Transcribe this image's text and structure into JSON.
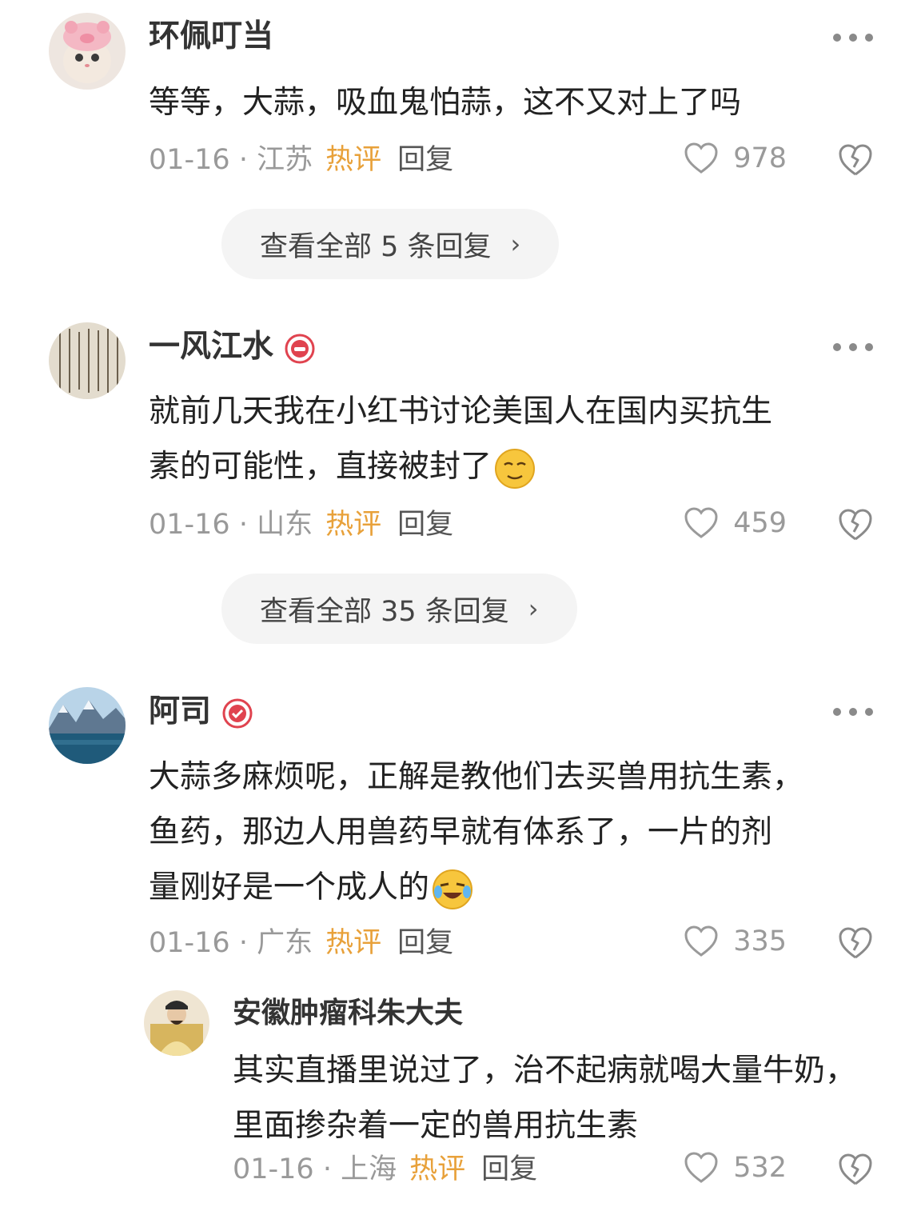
{
  "comments": [
    {
      "user": "环佩叮当",
      "text_lines": [
        "等等，大蒜，吸血鬼怕蒜，这不又对上了吗"
      ],
      "date": "01-16",
      "location": "江苏",
      "hot_label": "热评",
      "reply_label": "回复",
      "likes": "978",
      "view_replies": "查看全部 5 条回复"
    },
    {
      "user": "一风江水",
      "text_lines": [
        "就前几天我在小红书讨论美国人在国内买抗生",
        "素的可能性，直接被封了"
      ],
      "date": "01-16",
      "location": "山东",
      "hot_label": "热评",
      "reply_label": "回复",
      "likes": "459",
      "view_replies": "查看全部 35 条回复"
    },
    {
      "user": "阿司",
      "text_lines": [
        "大蒜多麻烦呢，正解是教他们去买兽用抗生素，",
        "鱼药，那边人用兽药早就有体系了，一片的剂",
        "量刚好是一个成人的"
      ],
      "date": "01-16",
      "location": "广东",
      "hot_label": "热评",
      "reply_label": "回复",
      "likes": "335"
    }
  ],
  "reply": {
    "user": "安徽肿瘤科朱大夫",
    "text_lines": [
      "其实直播里说过了，治不起病就喝大量牛奶，",
      "里面掺杂着一定的兽用抗生素"
    ],
    "date": "01-16",
    "location": "上海",
    "hot_label": "热评",
    "reply_label": "回复",
    "likes": "532"
  },
  "separator": " · ",
  "icons": {
    "more": "more-dots-icon",
    "like": "heart-icon",
    "dislike": "broken-heart-icon",
    "chevron": "chevron-right-icon",
    "badge": "verified-badge-icon"
  },
  "colors": {
    "hot": "#e8a13a",
    "meta": "#999999",
    "badge": "#e0434f"
  }
}
